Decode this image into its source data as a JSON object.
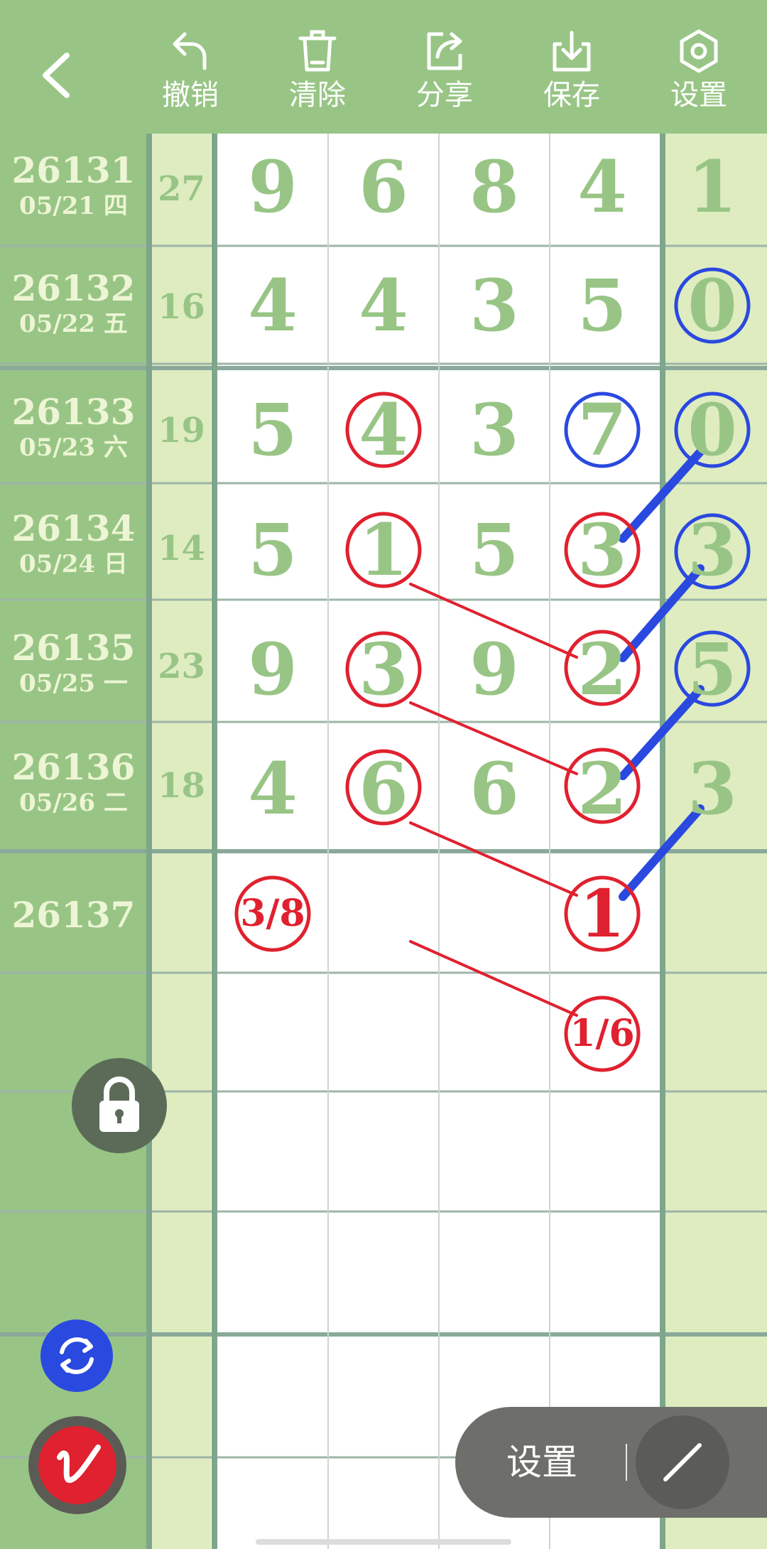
{
  "toolbar": {
    "back_icon": "chevron-left-icon",
    "buttons": [
      {
        "label": "撤销",
        "icon": "undo-icon"
      },
      {
        "label": "清除",
        "icon": "trash-icon"
      },
      {
        "label": "分享",
        "icon": "share-icon"
      },
      {
        "label": "保存",
        "icon": "download-icon"
      },
      {
        "label": "设置",
        "icon": "hexagon-settings-icon"
      }
    ]
  },
  "colors": {
    "toolbar_bg": "#98c585",
    "label_column_bg": "#98c585",
    "digit_green": "#98c585",
    "light_green_column": "#deecc0",
    "red_mark": "#e0212f",
    "blue_mark": "#2a49df"
  },
  "rows": [
    {
      "issue": "26131",
      "date": "05/21 四",
      "sum": "27",
      "digits": [
        "9",
        "6",
        "8",
        "4",
        "1"
      ]
    },
    {
      "issue": "26132",
      "date": "05/22 五",
      "sum": "16",
      "digits": [
        "4",
        "4",
        "3",
        "5",
        "0"
      ]
    },
    {
      "issue": "26133",
      "date": "05/23 六",
      "sum": "19",
      "digits": [
        "5",
        "4",
        "3",
        "7",
        "0"
      ]
    },
    {
      "issue": "26134",
      "date": "05/24 日",
      "sum": "14",
      "digits": [
        "5",
        "1",
        "5",
        "3",
        "3"
      ]
    },
    {
      "issue": "26135",
      "date": "05/25 一",
      "sum": "23",
      "digits": [
        "9",
        "3",
        "9",
        "2",
        "5"
      ]
    },
    {
      "issue": "26136",
      "date": "05/26 二",
      "sum": "18",
      "digits": [
        "4",
        "6",
        "6",
        "2",
        "3"
      ]
    },
    {
      "issue": "26137",
      "date": "",
      "sum": "",
      "digits": [
        "",
        "",
        "",
        "",
        ""
      ]
    }
  ],
  "annotations": {
    "predictions": [
      "3/8",
      "1",
      "1/6"
    ]
  },
  "floating": {
    "lock_icon": "lock-icon",
    "refresh_icon": "refresh-icon",
    "pen_icon": "pen-icon",
    "settings_label": "设置",
    "draw_icon": "line-draw-icon"
  }
}
